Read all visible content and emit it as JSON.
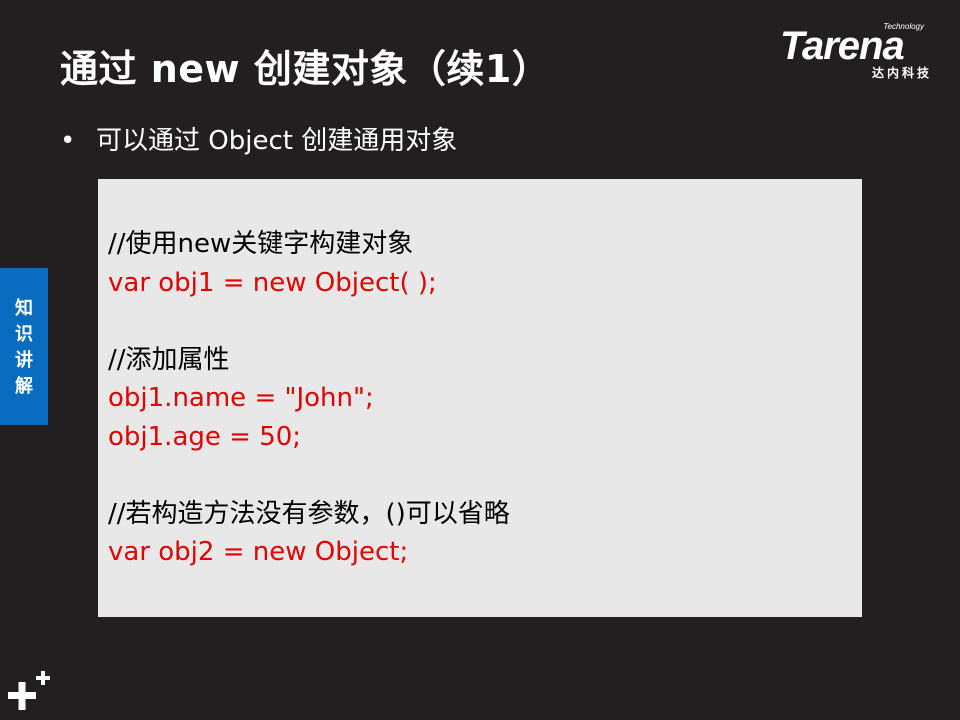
{
  "title": "通过 new 创建对象（续1）",
  "logo": {
    "word": "Tarena",
    "tagline": "Technology",
    "cn": "达内科技"
  },
  "bullet": {
    "symbol": "•",
    "text": "可以通过 Object 创建通用对象"
  },
  "code_block": {
    "lines": [
      {
        "type": "comment",
        "text": "//使用new关键字构建对象"
      },
      {
        "type": "code",
        "text": "var obj1 = new Object( );"
      },
      {
        "type": "blank",
        "text": ""
      },
      {
        "type": "comment",
        "text": "//添加属性"
      },
      {
        "type": "code",
        "text": "obj1.name = \"John\";"
      },
      {
        "type": "code",
        "text": "obj1.age = 50;"
      },
      {
        "type": "blank",
        "text": ""
      },
      {
        "type": "comment",
        "text": "//若构造方法没有参数，()可以省略"
      },
      {
        "type": "code",
        "text": "var obj2 = new Object;"
      }
    ]
  },
  "side_tab": {
    "label": "知识讲解"
  },
  "corner_icon": "plus-icon",
  "colors": {
    "background": "#231f20",
    "code_box": "#e8e8e8",
    "code_text": "#e00000",
    "comment_text": "#000000",
    "side_tab": "#0a6cbf"
  }
}
